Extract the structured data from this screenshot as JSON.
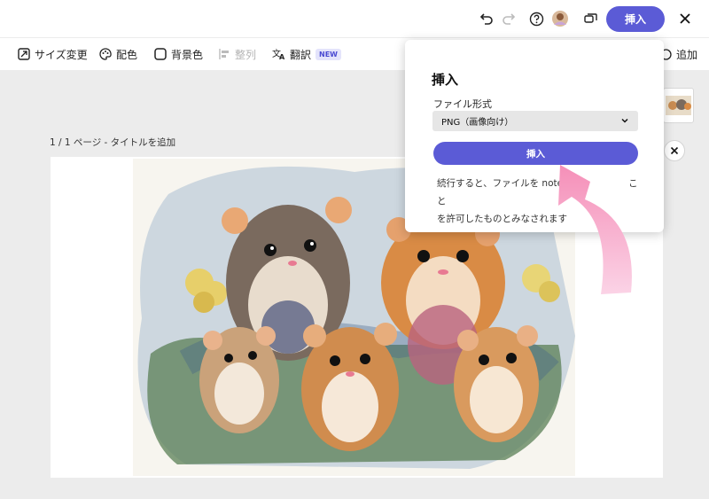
{
  "topbar": {
    "insert_label": "挿入"
  },
  "toolbar": {
    "resize_label": "サイズ変更",
    "color_label": "配色",
    "background_label": "背景色",
    "align_label": "整列",
    "translate_label": "翻訳",
    "new_badge": "NEW",
    "add_label": "追加"
  },
  "canvas": {
    "page_label": "1 / 1 ページ - タイトルを追加"
  },
  "popover": {
    "title": "挿入",
    "file_format_label": "ファイル形式",
    "selected_format": "PNG（画像向け）",
    "insert_label": "挿入",
    "note_line1": "続行すると、ファイルを note",
    "note_line1_tail": "こと",
    "note_line2": "を許可したものとみなされます"
  },
  "colors": {
    "accent": "#5b5bd6",
    "arrow": "#f7a8cf",
    "canvas_bg": "#ececec"
  }
}
